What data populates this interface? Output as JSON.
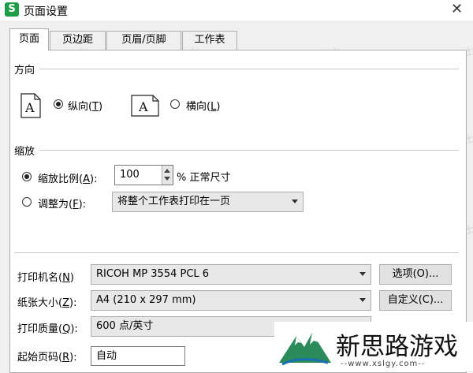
{
  "app": {
    "icon_letter": "S",
    "title": "页面设置"
  },
  "tabs": [
    {
      "label": "页面"
    },
    {
      "label": "页边距"
    },
    {
      "label": "页眉/页脚"
    },
    {
      "label": "工作表"
    }
  ],
  "orientation": {
    "heading": "方向",
    "portrait": {
      "label": "纵向",
      "hotkey": "T",
      "selected": true
    },
    "landscape": {
      "label": "横向",
      "hotkey": "L",
      "selected": false
    },
    "icon_letter": "A"
  },
  "scaling": {
    "heading": "缩放",
    "scale": {
      "label": "缩放比例",
      "hotkey": "A",
      "value": "100",
      "suffix": "% 正常尺寸",
      "selected": true
    },
    "fit": {
      "label": "调整为",
      "hotkey": "F",
      "value": "将整个工作表打印在一页",
      "selected": false
    }
  },
  "printer": {
    "label": "打印机名",
    "hotkey": "N",
    "value": "RICOH MP 3554 PCL 6",
    "options_button": "选项(O)..."
  },
  "paper": {
    "label": "纸张大小",
    "hotkey": "Z",
    "value": "A4 (210 x 297 mm)",
    "custom_button": "自定义(C)..."
  },
  "quality": {
    "label": "打印质量",
    "hotkey": "Q",
    "value": "600 点/英寸"
  },
  "first_page": {
    "label": "起始页码",
    "hotkey": "R",
    "value": "自动"
  },
  "watermark_text": "@打印机卫士",
  "brand": {
    "name": "新思路游戏",
    "url": "--www.xslgy.com--"
  },
  "colors": {
    "accent": "#1e9e49",
    "logo_green": "#2a8a5a",
    "logo_blue": "#1a6fb0"
  }
}
